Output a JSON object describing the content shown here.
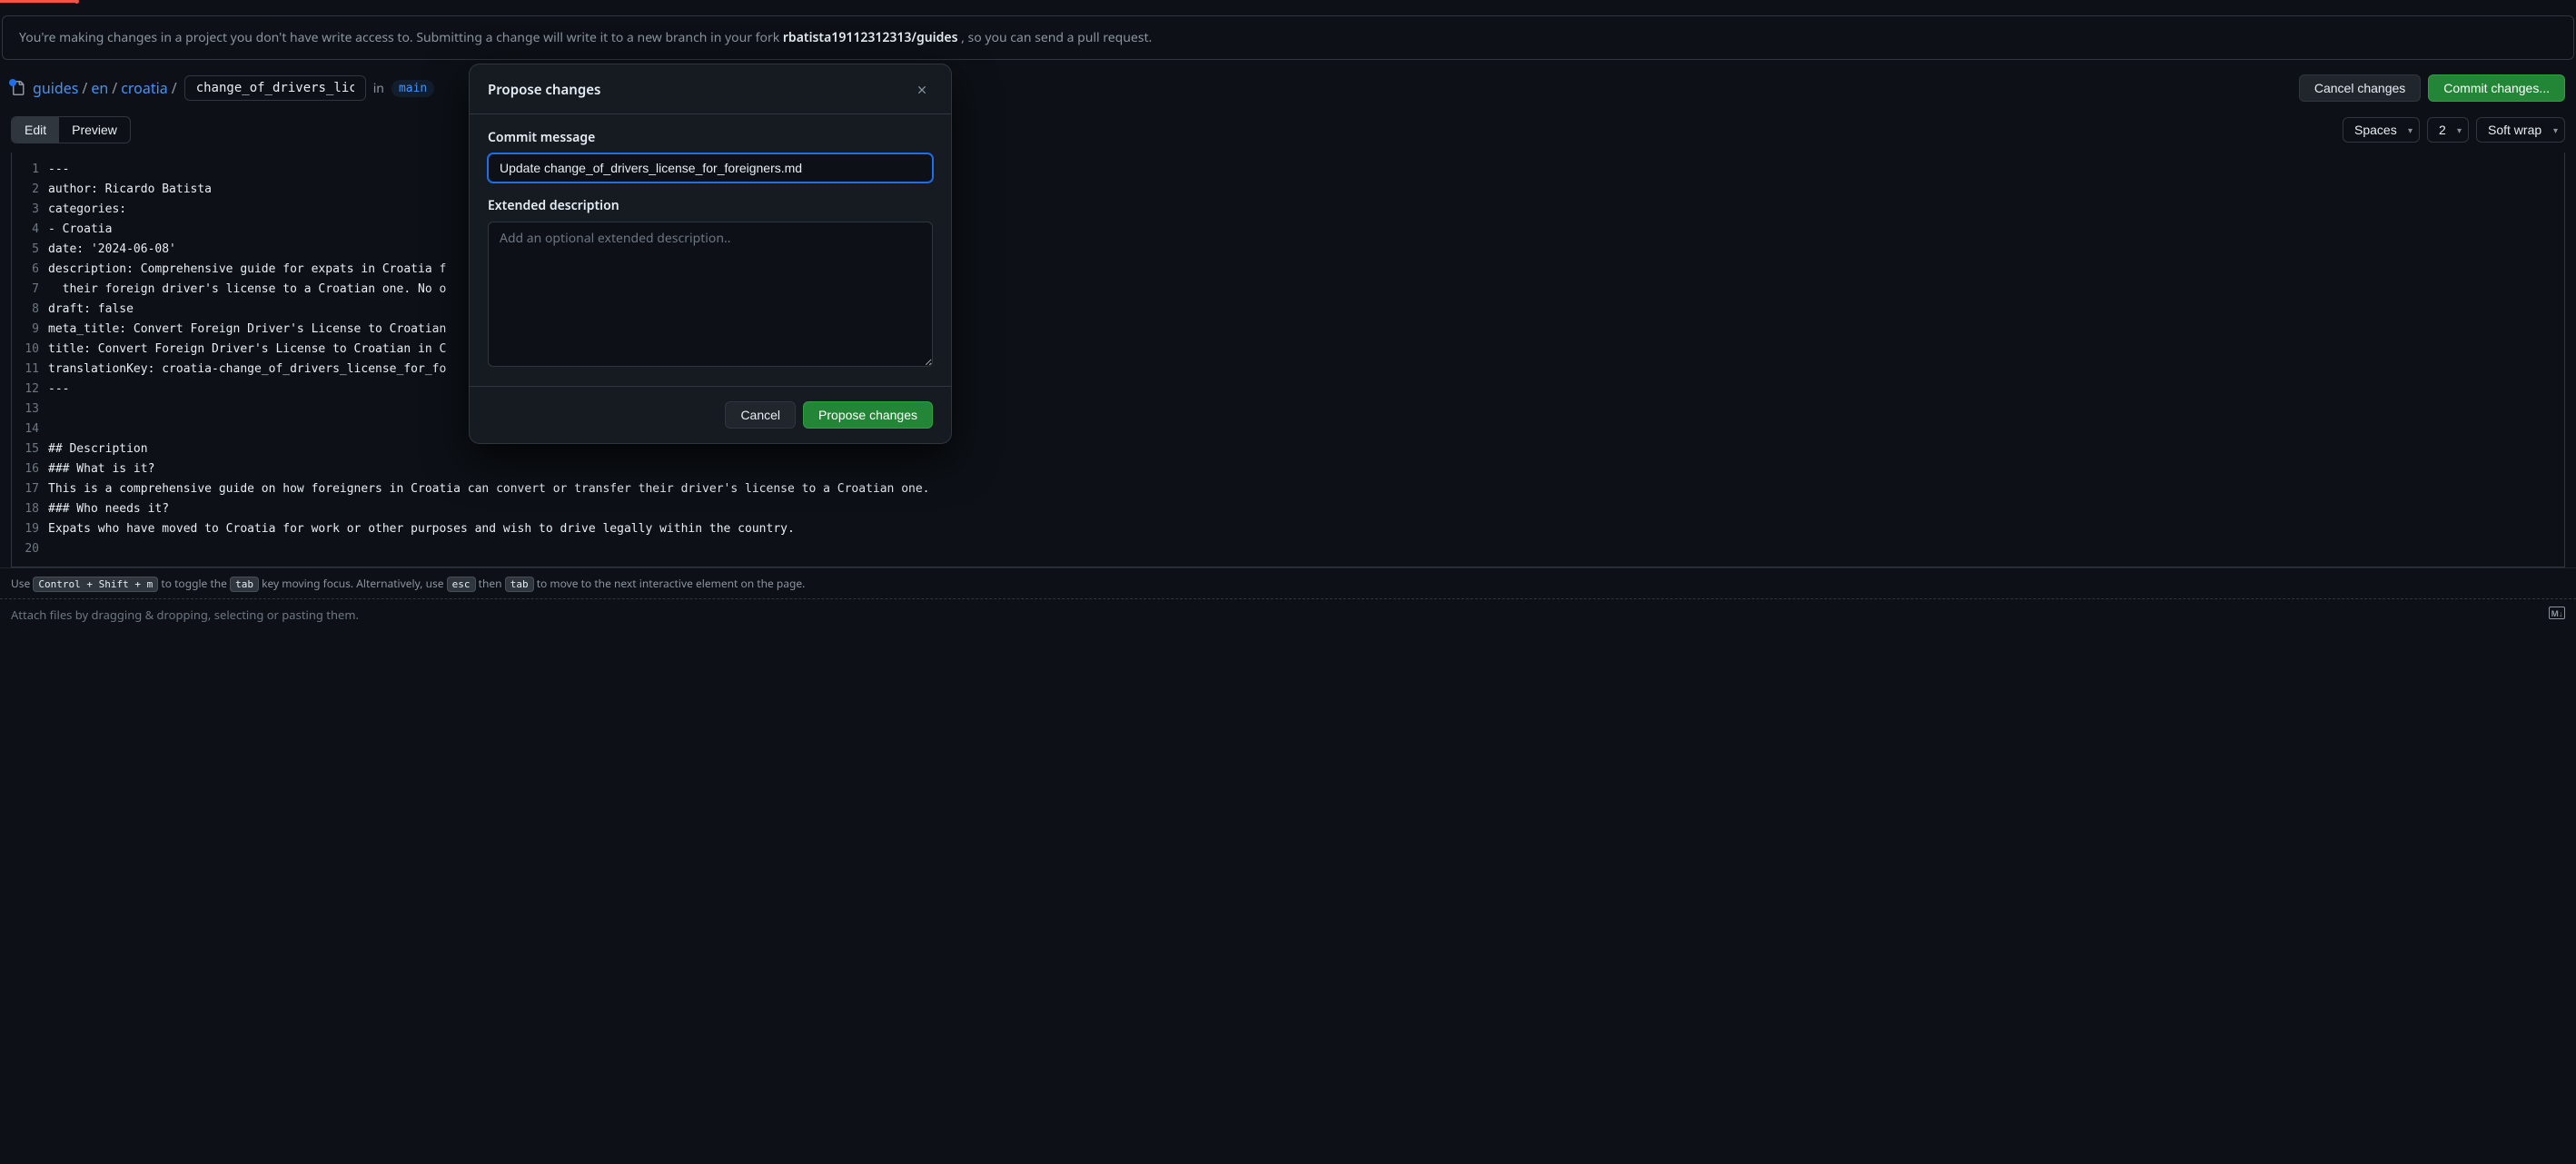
{
  "banner": {
    "prefix": "You're making changes in a project you don't have write access to. Submitting a change will write it to a new branch in your fork ",
    "fork": "rbatista19112312313/guides",
    "suffix": ", so you can send a pull request."
  },
  "breadcrumb": {
    "root": "guides",
    "parts": [
      "en",
      "croatia"
    ],
    "filename": "change_of_drivers_licen",
    "in_label": "in",
    "branch": "main"
  },
  "actions": {
    "cancel_changes": "Cancel changes",
    "commit_changes": "Commit changes..."
  },
  "tabs": {
    "edit": "Edit",
    "preview": "Preview"
  },
  "toolbar": {
    "indent_mode": "Spaces",
    "indent_size": "2",
    "wrap_mode": "Soft wrap"
  },
  "editor": {
    "lines": [
      "---",
      "author: Ricardo Batista",
      "categories:",
      "- Croatia",
      "date: '2024-06-08'",
      "description: Comprehensive guide for expats in Croatia f",
      "  their foreign driver's license to a Croatian one. No o",
      "draft: false",
      "meta_title: Convert Foreign Driver's License to Croatian",
      "title: Convert Foreign Driver's License to Croatian in C",
      "translationKey: croatia-change_of_drivers_license_for_fo",
      "---",
      "",
      "",
      "## Description",
      "### What is it?",
      "This is a comprehensive guide on how foreigners in Croatia can convert or transfer their driver's license to a Croatian one.",
      "### Who needs it?",
      "Expats who have moved to Croatia for work or other purposes and wish to drive legally within the country.",
      ""
    ],
    "line_numbers": [
      "1",
      "2",
      "3",
      "4",
      "5",
      "6",
      "7",
      "8",
      "9",
      "10",
      "11",
      "12",
      "13",
      "14",
      "15",
      "16",
      "17",
      "18",
      "19",
      "20"
    ]
  },
  "hint": {
    "use": "Use ",
    "kbd1": "Control + Shift + m",
    "t1": " to toggle the ",
    "kbd2": "tab",
    "t2": " key moving focus. Alternatively, use ",
    "kbd3": "esc",
    "t3": " then ",
    "kbd4": "tab",
    "t4": " to move to the next interactive element on the page."
  },
  "attach": "Attach files by dragging & dropping, selecting or pasting them.",
  "modal": {
    "title": "Propose changes",
    "commit_label": "Commit message",
    "commit_value": "Update change_of_drivers_license_for_foreigners.md",
    "extended_label": "Extended description",
    "extended_placeholder": "Add an optional extended description..",
    "cancel": "Cancel",
    "submit": "Propose changes"
  }
}
